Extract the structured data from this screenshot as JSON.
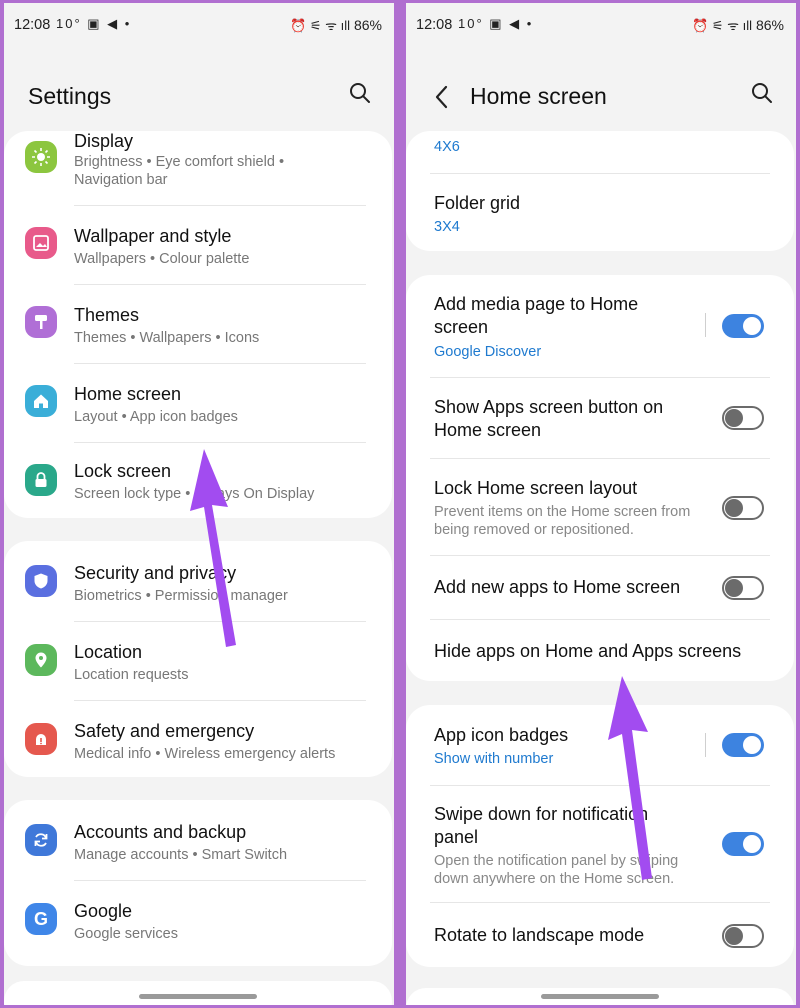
{
  "status": {
    "time": "12:08",
    "temp": "10°",
    "battery": "86%"
  },
  "left": {
    "title": "Settings",
    "items": [
      {
        "title": "Display",
        "sub": "Brightness  •  Eye comfort shield  •",
        "sub2": "Navigation bar",
        "color": "#8cc63f"
      },
      {
        "title": "Wallpaper and style",
        "sub": "Wallpapers  •  Colour palette",
        "color": "#e85a8a"
      },
      {
        "title": "Themes",
        "sub": "Themes  •  Wallpapers  •  Icons",
        "color": "#b06fd6"
      },
      {
        "title": "Home screen",
        "sub": "Layout  •  App icon badges",
        "color": "#3aaed8"
      },
      {
        "title": "Lock screen",
        "sub": "Screen lock type  •  Always On Display",
        "color": "#2aa88a"
      },
      {
        "title": "Security and privacy",
        "sub": "Biometrics  •  Permission manager",
        "color": "#5a6fe0"
      },
      {
        "title": "Location",
        "sub": "Location requests",
        "color": "#5cb85c"
      },
      {
        "title": "Safety and emergency",
        "sub": "Medical info  •  Wireless emergency alerts",
        "color": "#e5584e"
      },
      {
        "title": "Accounts and backup",
        "sub": "Manage accounts  •  Smart Switch",
        "color": "#3f78d9"
      },
      {
        "title": "Google",
        "sub": "Google services",
        "color": "#3f86e8"
      }
    ]
  },
  "right": {
    "title": "Home screen",
    "apps_grid_value": "4X6",
    "folder_grid": {
      "title": "Folder grid",
      "value": "3X4"
    },
    "media_page": {
      "title1": "Add media page to Home",
      "title2": "screen",
      "value": "Google Discover",
      "on": true
    },
    "show_apps_button": {
      "title1": "Show Apps screen button on",
      "title2": "Home screen",
      "on": false
    },
    "lock_layout": {
      "title": "Lock Home screen layout",
      "sub1": "Prevent items on the Home screen from",
      "sub2": "being removed or repositioned.",
      "on": false
    },
    "add_new_apps": {
      "title": "Add new apps to Home screen",
      "on": false
    },
    "hide_apps": {
      "title": "Hide apps on Home and Apps screens"
    },
    "app_icon_badges": {
      "title": "App icon badges",
      "value": "Show with number",
      "on": true
    },
    "swipe_down": {
      "title1": "Swipe down for notification",
      "title2": "panel",
      "sub1": "Open the notification panel by swiping",
      "sub2": "down anywhere on the Home screen.",
      "on": true
    },
    "rotate": {
      "title": "Rotate to landscape mode",
      "on": false
    }
  },
  "colors": {
    "accent": "#3d83e0",
    "link": "#1f7acf",
    "arrow": "#a24cf0"
  }
}
